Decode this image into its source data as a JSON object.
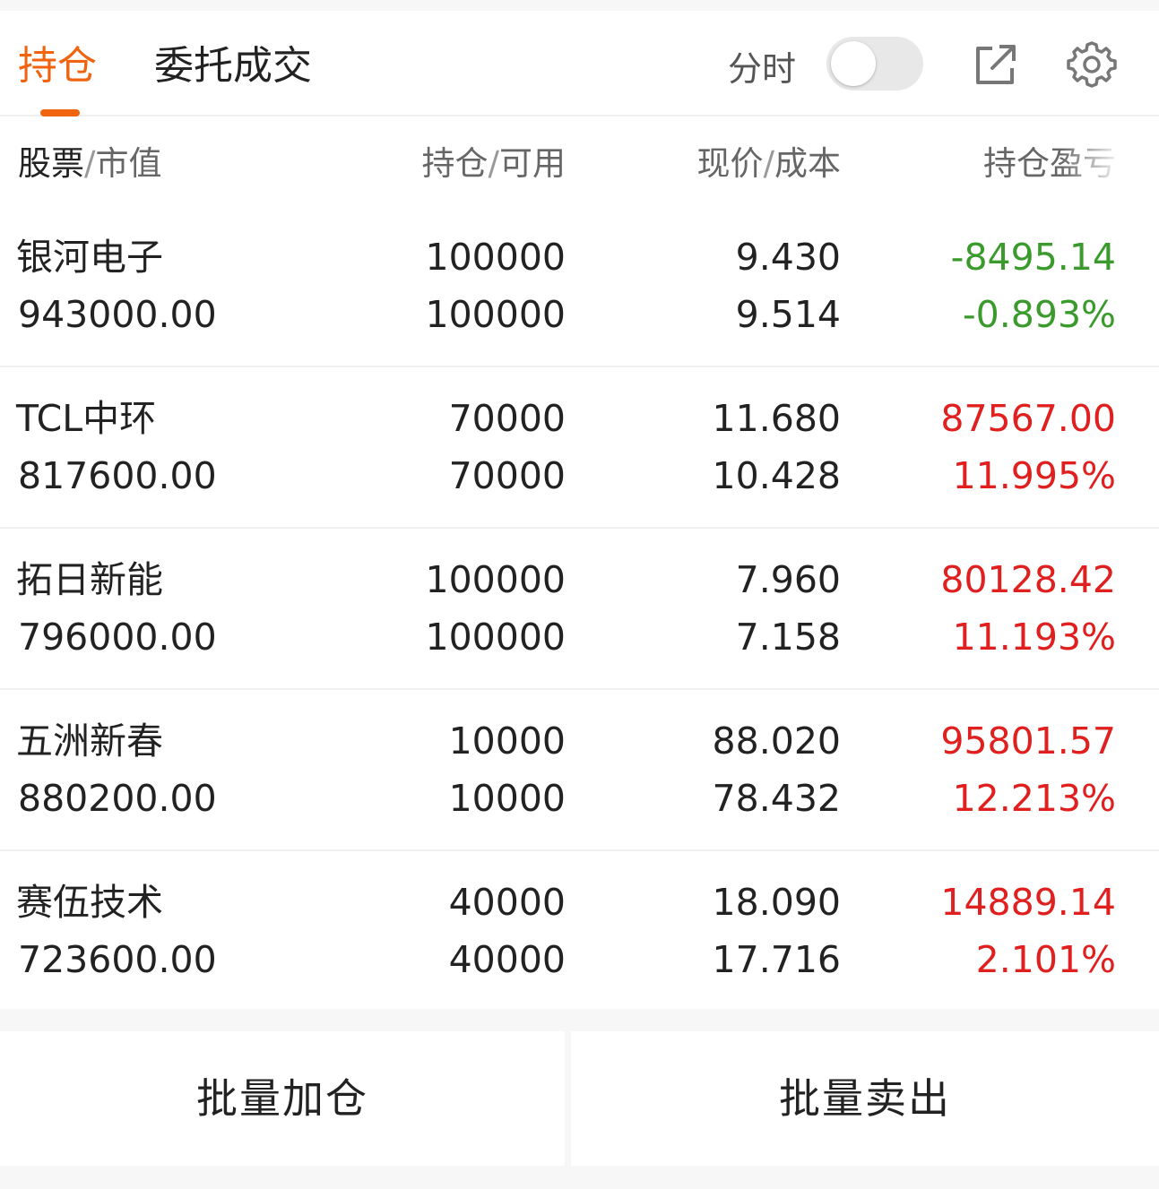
{
  "tabs": {
    "holdings": "持仓",
    "orders": "委托成交"
  },
  "toolbar": {
    "timeshare_label": "分时",
    "timeshare_on": false
  },
  "columns": {
    "stock": "股票",
    "market_value": "市值",
    "position": "持仓",
    "available": "可用",
    "price": "现价",
    "cost": "成本",
    "pnl": "持仓盈亏",
    "separator": "/"
  },
  "colors": {
    "accent": "#f0640f",
    "gain": "#e01f1f",
    "loss": "#3a9b2c"
  },
  "positions": [
    {
      "name": "银河电子",
      "market_value": "943000.00",
      "position": "100000",
      "available": "100000",
      "price": "9.430",
      "cost": "9.514",
      "pnl": "-8495.14",
      "pnl_pct": "-0.893%",
      "trend": "loss"
    },
    {
      "name": "TCL中环",
      "market_value": "817600.00",
      "position": "70000",
      "available": "70000",
      "price": "11.680",
      "cost": "10.428",
      "pnl": "87567.00",
      "pnl_pct": "11.995%",
      "trend": "gain"
    },
    {
      "name": "拓日新能",
      "market_value": "796000.00",
      "position": "100000",
      "available": "100000",
      "price": "7.960",
      "cost": "7.158",
      "pnl": "80128.42",
      "pnl_pct": "11.193%",
      "trend": "gain"
    },
    {
      "name": "五洲新春",
      "market_value": "880200.00",
      "position": "10000",
      "available": "10000",
      "price": "88.020",
      "cost": "78.432",
      "pnl": "95801.57",
      "pnl_pct": "12.213%",
      "trend": "gain"
    },
    {
      "name": "赛伍技术",
      "market_value": "723600.00",
      "position": "40000",
      "available": "40000",
      "price": "18.090",
      "cost": "17.716",
      "pnl": "14889.14",
      "pnl_pct": "2.101%",
      "trend": "gain"
    }
  ],
  "actions": {
    "batch_add": "批量加仓",
    "batch_sell": "批量卖出"
  }
}
